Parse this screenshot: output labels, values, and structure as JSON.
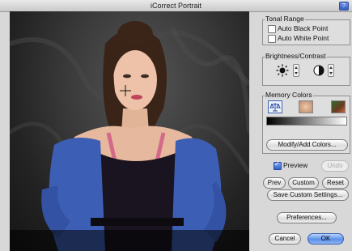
{
  "window": {
    "title": "iCorrect Portrait",
    "help_label": "?"
  },
  "tonal_range": {
    "title": "Tonal Range",
    "auto_black_point": {
      "label": "Auto Black Point",
      "checked": false
    },
    "auto_white_point": {
      "label": "Auto White Point",
      "checked": false
    }
  },
  "brightness_contrast": {
    "title": "Brightness/Contrast",
    "icons": [
      "brightness-sun-icon",
      "contrast-circle-icon"
    ]
  },
  "memory_colors": {
    "title": "Memory Colors",
    "swatches": [
      "neutral-balance-icon",
      "skin-tone-icon",
      "foliage-icon"
    ],
    "modify_button": "Modify/Add Colors..."
  },
  "preview": {
    "label": "Preview",
    "checked": true
  },
  "buttons": {
    "undo": "Undo",
    "prev": "Prev",
    "custom": "Custom",
    "reset": "Reset",
    "save_custom": "Save Custom Settings...",
    "preferences": "Preferences...",
    "cancel": "Cancel",
    "ok": "OK"
  },
  "colors": {
    "accent": "#5b8fe6",
    "photo_bg": "#2a2a2a",
    "cardigan": "#3c5fb5"
  }
}
